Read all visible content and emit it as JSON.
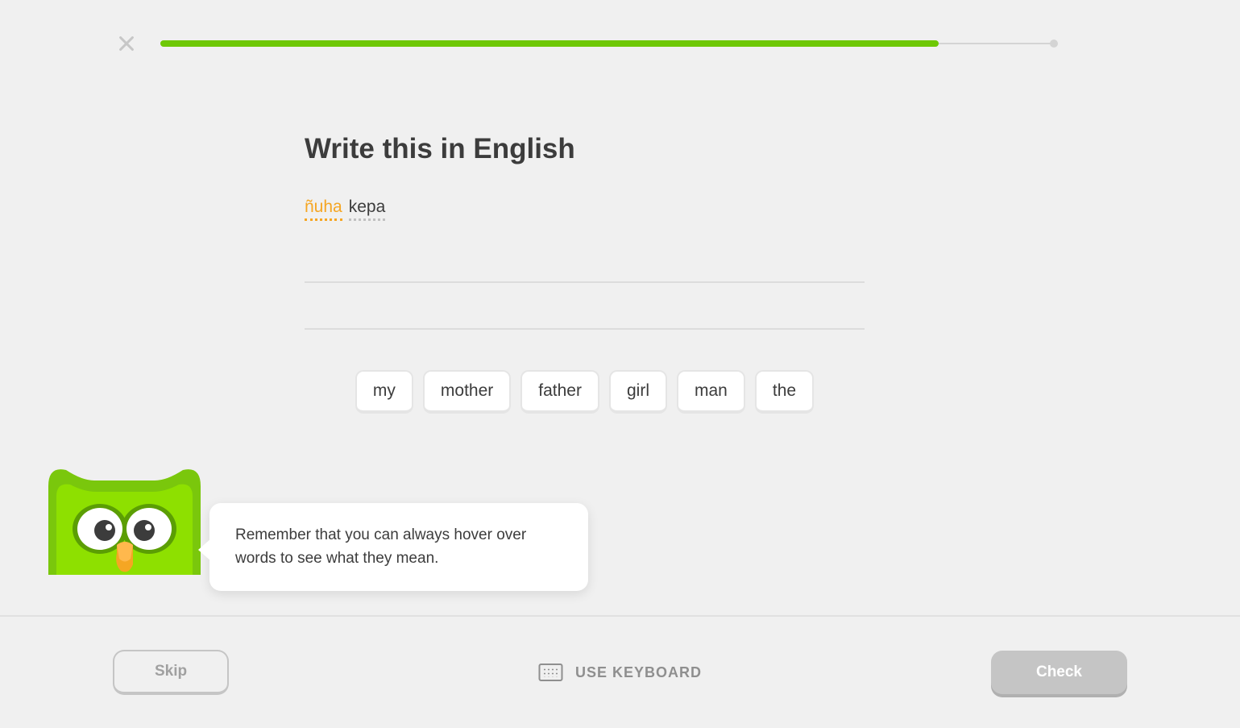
{
  "progress": {
    "percent": 87
  },
  "exercise": {
    "title": "Write this in English",
    "prompt_words": [
      {
        "text": "ñuha",
        "is_new": true
      },
      {
        "text": "kepa",
        "is_new": false
      }
    ],
    "word_bank": [
      "my",
      "mother",
      "father",
      "girl",
      "man",
      "the"
    ]
  },
  "hint": {
    "text": "Remember that you can always hover over words to see what they mean."
  },
  "footer": {
    "skip_label": "Skip",
    "keyboard_label": "USE KEYBOARD",
    "check_label": "Check"
  }
}
